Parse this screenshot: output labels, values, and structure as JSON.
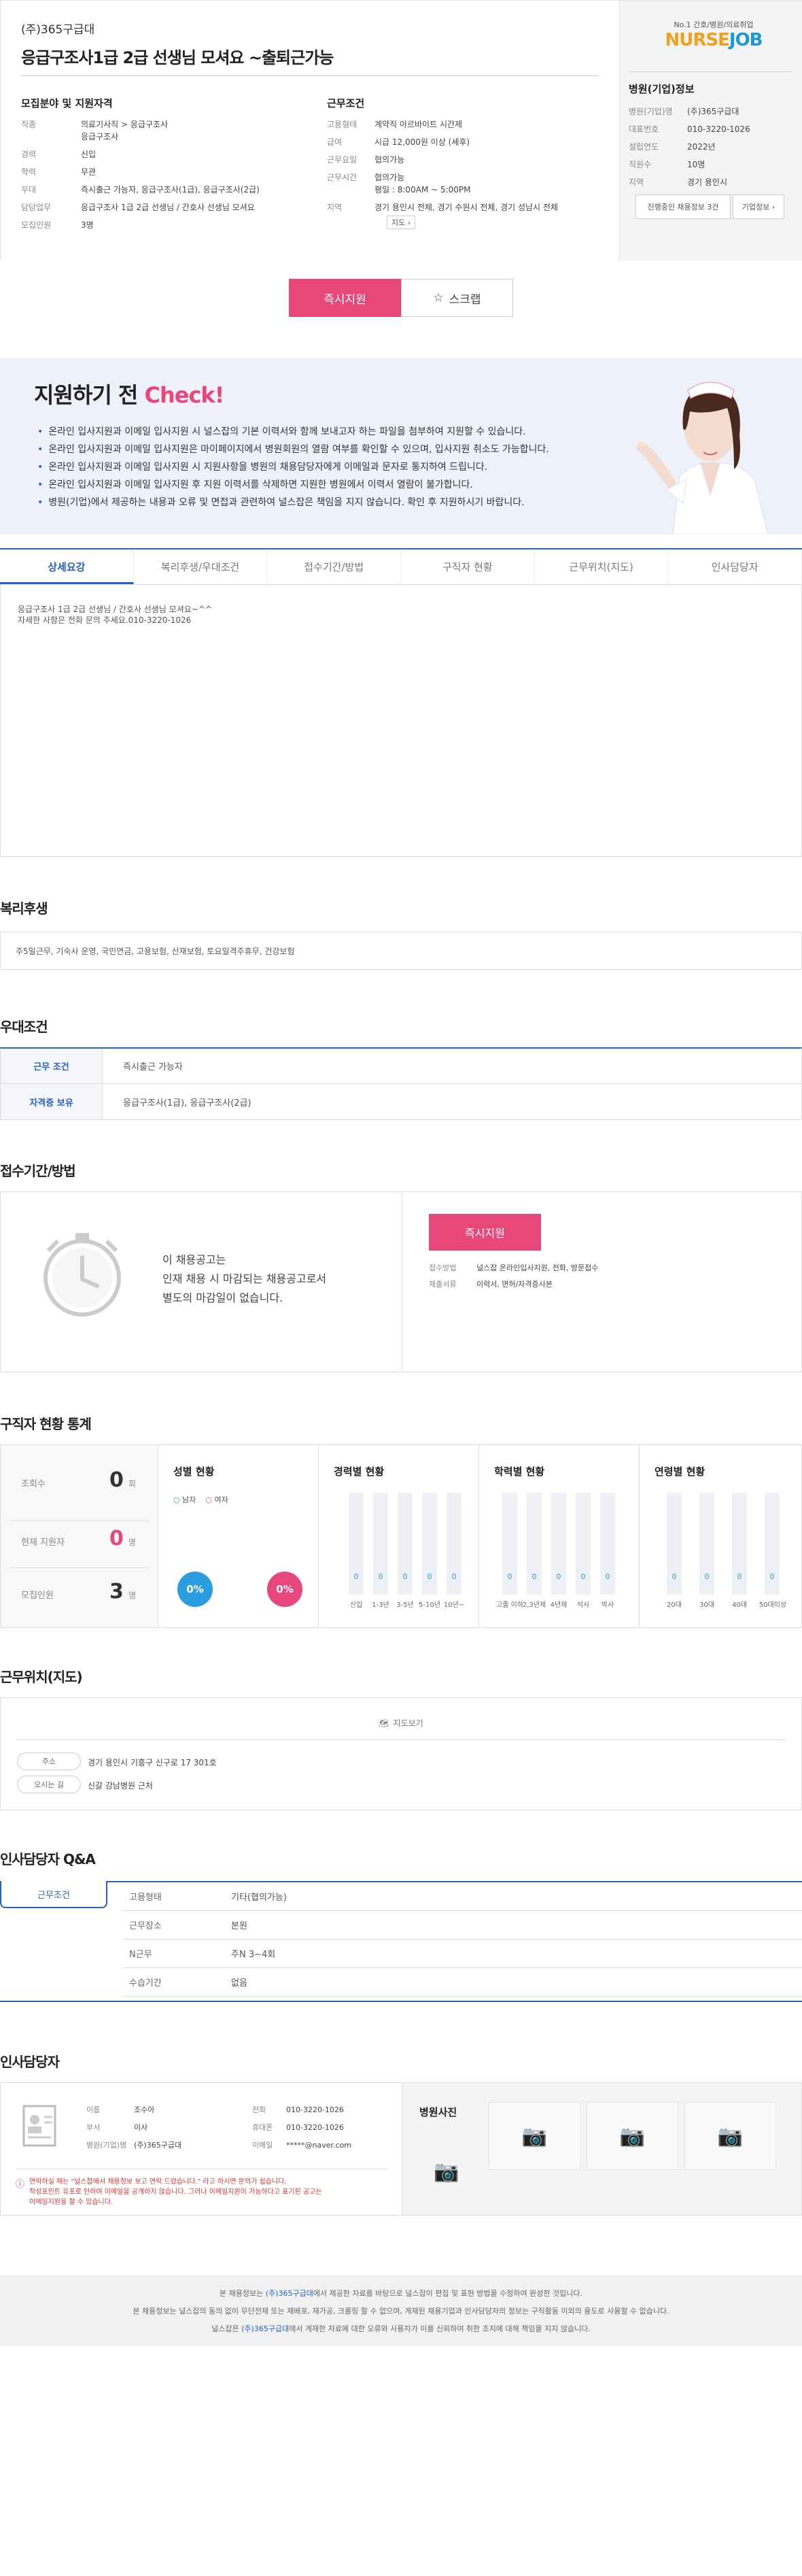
{
  "header": {
    "company": "(주)365구급대",
    "title": "응급구조사1급 2급 선생님 모셔요 ~출퇴근가능",
    "section_left": "모집분야 및 지원자격",
    "section_right": "근무조건",
    "left_rows": [
      {
        "k": "직종",
        "v": "의료기사직 > 응급구조사"
      },
      {
        "k": "",
        "v": "응급구조사"
      },
      {
        "k": "경력",
        "v": "신입"
      },
      {
        "k": "학력",
        "v": "무관"
      },
      {
        "k": "우대",
        "v": "즉시출근 가능자, 응급구조사(1급), 응급구조사(2급)"
      },
      {
        "k": "담당업무",
        "v": "응급구조사 1급 2급 선생님 / 간호사 선생님 모셔요"
      },
      {
        "k": "모집인원",
        "v": "3명"
      }
    ],
    "right_rows": [
      {
        "k": "고용형태",
        "v": "계약직 아르바이트 시간제"
      },
      {
        "k": "급여",
        "v": "시급 12,000원 이상 (세후)"
      },
      {
        "k": "근무요일",
        "v": "협의가능"
      },
      {
        "k": "근무시간",
        "v": "협의가능"
      },
      {
        "k": "",
        "v": "평일 : 8:00AM ~ 5:00PM"
      },
      {
        "k": "지역",
        "v": "경기 용인시 전체, 경기 수원시 전체, 경기 성남시 전체"
      }
    ],
    "map_btn": "지도"
  },
  "brand": {
    "tagline": "No.1 간호/병원/의료취업",
    "logo_a": "NURSE",
    "logo_b": "JOB"
  },
  "company_info": {
    "title": "병원(기업)정보",
    "rows": [
      {
        "k": "병원(기업)명",
        "v": "(주)365구급대"
      },
      {
        "k": "대표번호",
        "v": "010-3220-1026"
      },
      {
        "k": "설립연도",
        "v": "2022년"
      },
      {
        "k": "직원수",
        "v": "10명"
      },
      {
        "k": "지역",
        "v": "경기 용인시"
      }
    ],
    "btn_ongoing": "진행중인 채용정보 3건",
    "btn_info": "기업정보"
  },
  "actions": {
    "apply": "즉시지원",
    "scrap": "스크랩"
  },
  "check": {
    "title_a": "지원하기 전 ",
    "title_b": "Check!",
    "items": [
      "온라인 입사지원과 이메일 입사지원 시 널스잡의 기본 이력서와 함께 보내고자 하는 파일을 첨부하여 지원할 수 있습니다.",
      "온라인 입사지원과 이메일 입사지원은 마이페이지에서 병원회원의 열람 여부를 확인할 수 있으며, 입사지원 취소도 가능합니다.",
      "온라인 입사지원과 이메일 입사지원 시 지원사항을 병원의 채용담당자에게 이메일과 문자로 통지하여 드립니다.",
      "온라인 입사지원과 이메일 입사지원 후 지원 이력서를 삭제하면 지원한 병원에서 이력서 열람이 불가합니다.",
      "병원(기업)에서 제공하는 내용과 오류 및 면접과 관련하여 널스잡은 책임을 지지 않습니다. 확인 후 지원하시기 바랍니다."
    ]
  },
  "tabs": [
    "상세요강",
    "복리후생/우대조건",
    "접수기간/방법",
    "구직자 현황",
    "근무위치(지도)",
    "인사담당자"
  ],
  "detail": {
    "line1": "응급구조사 1급 2급 선생님 / 간호사 선생님 모셔요~^^",
    "line2": "자세한 사항은 전화 문의 주세요.010-3220-1026"
  },
  "welfare": {
    "title": "복리후생",
    "text": "주5일근무, 기숙사 운영, 국민연금, 고용보험, 산재보험, 토요일격주휴무, 건강보험"
  },
  "preferred": {
    "title": "우대조건",
    "rows": [
      {
        "k": "근무 조건",
        "v": "즉시출근 가능자"
      },
      {
        "k": "자격증 보유",
        "v": "응급구조사(1급), 응급구조사(2급)"
      }
    ]
  },
  "reception": {
    "title": "접수기간/방법",
    "msg1": "이 채용공고는",
    "msg2": "인재 채용 시 마감되는 채용공고로서",
    "msg3": "별도의 마감일이 없습니다.",
    "apply": "즉시지원",
    "method_k": "접수방법",
    "method_v": "널스잡 온라인입사지원, 전화, 방문접수",
    "docs_k": "제출서류",
    "docs_v": "이력서, 면허/자격증사본"
  },
  "stats": {
    "title": "구직자 현황 통계",
    "views_k": "조회수",
    "views_v": "0",
    "views_u": "회",
    "applicants_k": "현재 지원자",
    "applicants_v": "0",
    "applicants_u": "명",
    "recruit_k": "모집인원",
    "recruit_v": "3",
    "recruit_u": "명",
    "gender_title": "성별 현황",
    "male": "남자",
    "female": "여자",
    "male_pct": "0%",
    "female_pct": "0%",
    "career_title": "경력별 현황",
    "career": [
      {
        "l": "신입",
        "v": "0"
      },
      {
        "l": "1-3년",
        "v": "0"
      },
      {
        "l": "3-5년",
        "v": "0"
      },
      {
        "l": "5-10년",
        "v": "0"
      },
      {
        "l": "10년~",
        "v": "0"
      }
    ],
    "edu_title": "학력별 현황",
    "edu": [
      {
        "l": "고졸 이하",
        "v": "0"
      },
      {
        "l": "2,3년제",
        "v": "0"
      },
      {
        "l": "4년제",
        "v": "0"
      },
      {
        "l": "석사",
        "v": "0"
      },
      {
        "l": "박사",
        "v": "0"
      }
    ],
    "age_title": "연령별 현황",
    "age": [
      {
        "l": "20대",
        "v": "0"
      },
      {
        "l": "30대",
        "v": "0"
      },
      {
        "l": "40대",
        "v": "0"
      },
      {
        "l": "50대이상",
        "v": "0"
      }
    ]
  },
  "location": {
    "title": "근무위치(지도)",
    "map_btn": "지도보기",
    "addr_k": "주소",
    "addr_v": "경기 용인시 기흥구 신구로 17 301호",
    "dir_k": "오시는 길",
    "dir_v": "신갈 강남병원 근처"
  },
  "qa": {
    "title": "인사담당자 Q&A",
    "tab": "근무조건",
    "rows": [
      {
        "k": "고용형태",
        "v": "기타(협의가능)"
      },
      {
        "k": "근무장소",
        "v": "본원"
      },
      {
        "k": "N근무",
        "v": "주N 3~4회"
      },
      {
        "k": "수습기간",
        "v": "없음"
      }
    ]
  },
  "manager": {
    "title": "인사담당자",
    "name_k": "이름",
    "name_v": "조수아",
    "dept_k": "부서",
    "dept_v": "이사",
    "hosp_k": "병원(기업)명",
    "hosp_v": "(주)365구급대",
    "tel_k": "전화",
    "tel_v": "010-3220-1026",
    "mobile_k": "휴대폰",
    "mobile_v": "010-3220-1026",
    "email_k": "이메일",
    "email_v": "*****@naver.com",
    "notice1": "연락하실 때는 \"널스잡에서 채용정보 보고 연락 드렸습니다.\" 라고 하시면 문의가 쉽습니다.",
    "notice2": "작성포인트 유포로 인하여 이메일을 공개하지 않습니다. 그러나 이메일지원이 가능하다고 표기된 공고는",
    "notice3": "이메일지원을 할 수 있습니다.",
    "photo_title": "병원사진"
  },
  "footer": {
    "line1a": "본 채용정보는 ",
    "line1b": "(주)365구급대",
    "line1c": "에서 제공한 자료를 바탕으로 널스잡이 편집 및 표현 방법을 수정하여 완성한 것입니다.",
    "line2": "본 채용정보는 널스잡의 동의 없이 무단전재 또는 재배포, 재가공, 크롤링 할 수 없으며, 게재된 채용기업과 인사담당자의 정보는 구직활동 이외의 용도로 사용할 수 없습니다.",
    "line3a": "널스잡은 ",
    "line3b": "(주)365구급대",
    "line3c": "에서 게재한 자료에 대한 오류와 사용자가 이를 신뢰하여 취한 조치에 대해 책임을 지지 않습니다."
  },
  "colors": {
    "accent": "#2460c8",
    "pink": "#e8477a",
    "male": "#2a9ee0",
    "female": "#e8477a"
  }
}
